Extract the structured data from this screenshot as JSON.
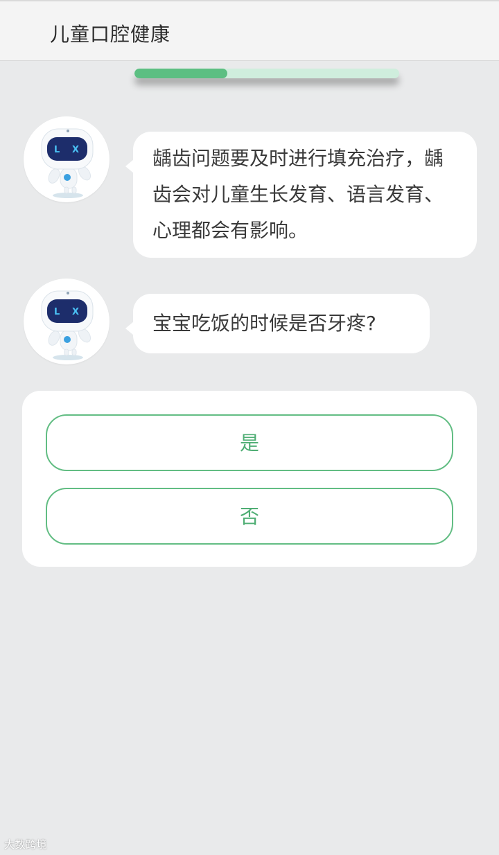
{
  "header": {
    "title": "儿童口腔健康"
  },
  "progress": {
    "fraction": 0.35
  },
  "messages": [
    {
      "sender": "robot",
      "text": "龋齿问题要及时进行填充治疗，龋齿会对儿童生长发育、语言发育、心理都会有影响。"
    },
    {
      "sender": "robot",
      "text": "宝宝吃饭的时候是否牙疼?"
    }
  ],
  "options": [
    {
      "label": "是"
    },
    {
      "label": "否"
    }
  ],
  "watermark": "大数跨境",
  "colors": {
    "accent_green": "#5cbf82",
    "background": "#e9eaeb",
    "bubble": "#ffffff",
    "robot_screen": "#1d2d6b",
    "robot_eyes": "#4ac0f4"
  }
}
